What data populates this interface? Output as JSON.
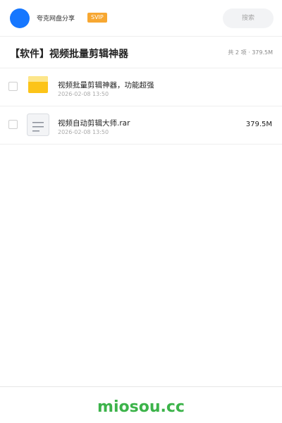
{
  "header": {
    "user_name": "夸克网盘分享",
    "badge": "SVIP",
    "search_placeholder": "搜索"
  },
  "title": {
    "text": "【软件】视频批量剪辑神器",
    "summary": "共 2 项 · 379.5M"
  },
  "files": [
    {
      "name": "视频批量剪辑神器，功能超强",
      "date": "2026-02-08 13:50",
      "size": "",
      "icon": "folder-icon"
    },
    {
      "name": "视频自动剪辑大师.rar",
      "date": "2026-02-08 13:50",
      "size": "379.5M",
      "icon": "archive-file-icon"
    }
  ],
  "footer": {
    "brand": "miosou.cc"
  },
  "colors": {
    "accent": "#1677ff",
    "badge": "#f7a731",
    "folder": "#fcc419",
    "brand": "#3cb34a"
  }
}
